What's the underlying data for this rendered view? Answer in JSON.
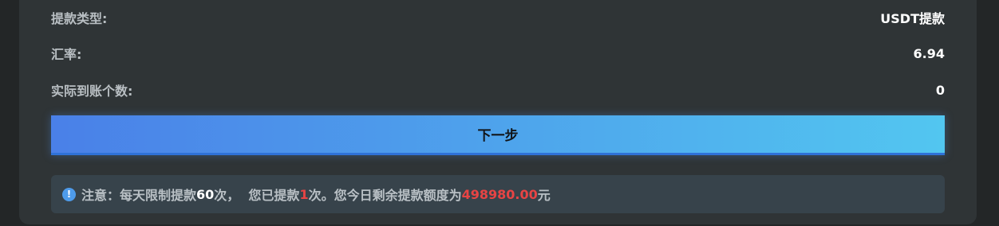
{
  "details": {
    "withdraw_type_label": "提款类型:",
    "withdraw_type_value": "USDT提款",
    "exchange_rate_label": "汇率:",
    "exchange_rate_value": "6.94",
    "actual_amount_label": "实际到账个数:",
    "actual_amount_value": "0"
  },
  "next_button_label": "下一步",
  "notice": {
    "icon": "info-icon",
    "prefix": "注意：每天限制提款",
    "daily_limit": "60",
    "mid1": "次，  您已提款",
    "used_count": "1",
    "mid2": "次。您今日剩余提款额度为",
    "remaining_amount": "498980.00",
    "suffix": "元"
  },
  "colors": {
    "accent_start": "#4a80e8",
    "accent_end": "#52c6f0",
    "highlight_red": "#e84444"
  }
}
